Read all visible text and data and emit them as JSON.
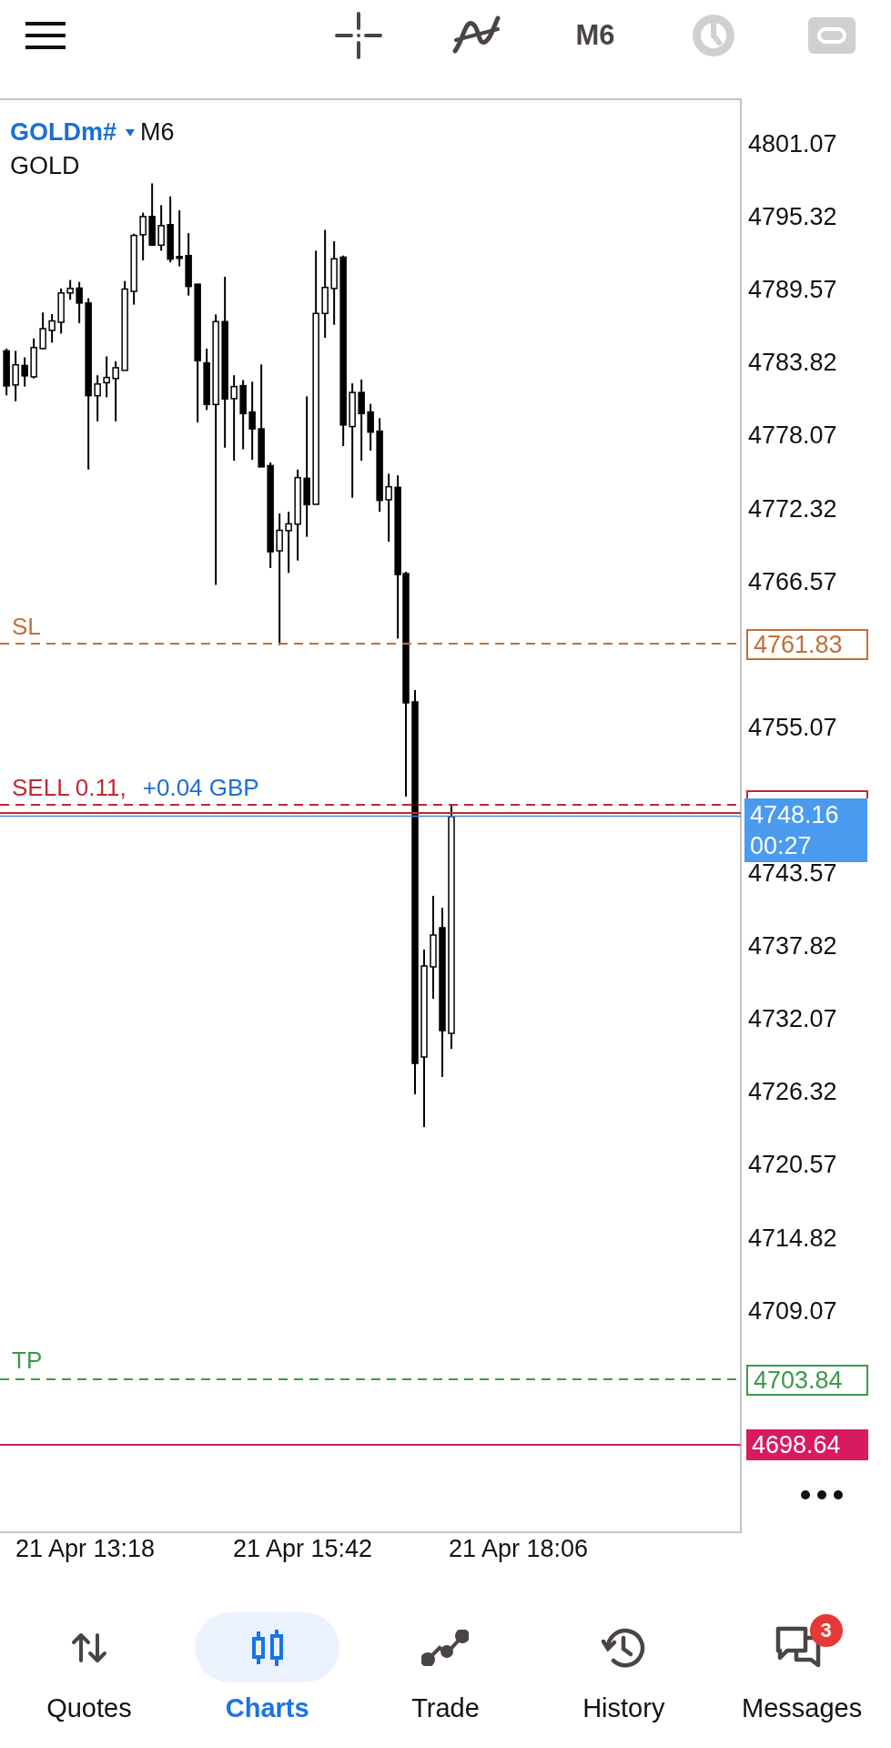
{
  "toolbar": {
    "timeframe": "M6"
  },
  "chart": {
    "symbol": "GOLDm#",
    "timeframe": "M6",
    "description": "GOLD",
    "price_ticks": [
      "4801.07",
      "4795.32",
      "4789.57",
      "4783.82",
      "4778.07",
      "4772.32",
      "4766.57",
      "4755.07",
      "4743.57",
      "4737.82",
      "4732.07",
      "4726.32",
      "4720.57",
      "4714.82",
      "4709.07"
    ],
    "time_ticks": [
      "21 Apr 13:18",
      "21 Apr 15:42",
      "21 Apr 18:06"
    ],
    "lines": [
      {
        "kind": "sl",
        "label": "SL",
        "price": "4761.83"
      },
      {
        "kind": "sell",
        "label": "SELL 0.11,",
        "profit": "+0.04 GBP"
      },
      {
        "kind": "tp",
        "label": "TP",
        "price": "4703.84"
      },
      {
        "kind": "marker",
        "price": "4698.64"
      }
    ],
    "current_price": {
      "price": "4748.16",
      "countdown": "00:27"
    }
  },
  "nav": [
    {
      "kind": "quotes",
      "label": "Quotes",
      "selected": false
    },
    {
      "kind": "charts",
      "label": "Charts",
      "selected": true
    },
    {
      "kind": "trade",
      "label": "Trade",
      "selected": false
    },
    {
      "kind": "history",
      "label": "History",
      "selected": false
    },
    {
      "kind": "messages",
      "label": "Messages",
      "badge": "3",
      "selected": false
    }
  ]
}
